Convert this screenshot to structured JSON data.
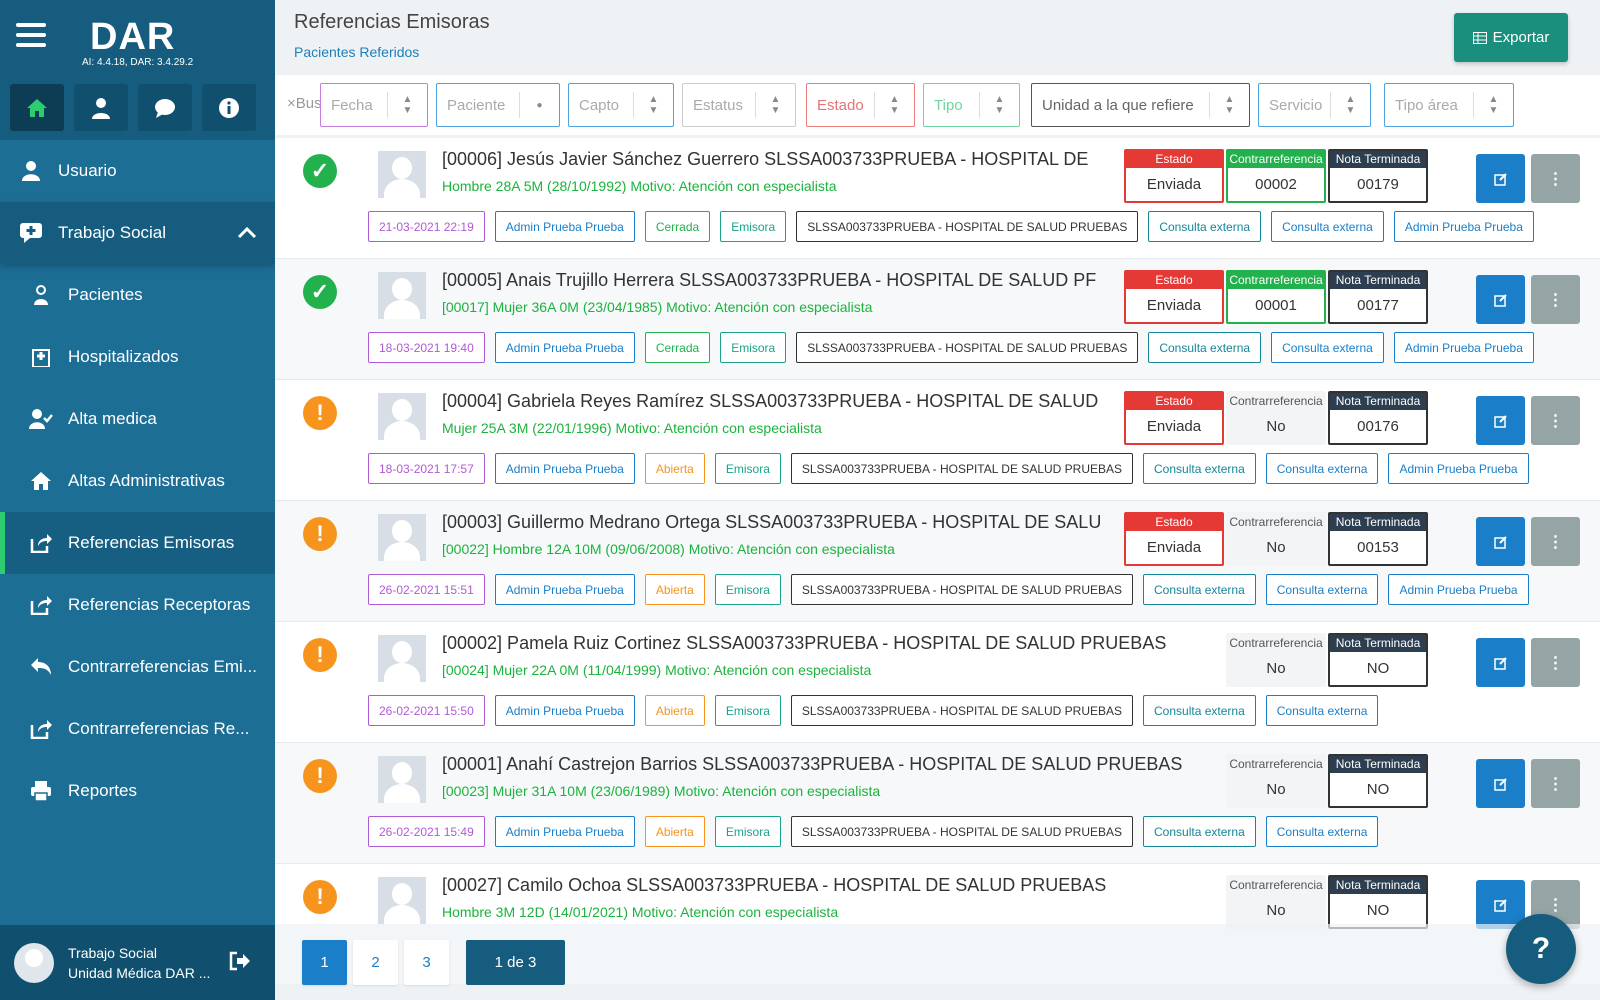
{
  "app": {
    "logo": "DAR",
    "version": "AI: 4.4.18, DAR: 3.4.29.2"
  },
  "sidebar": {
    "items": [
      {
        "label": "Usuario",
        "icon": "user-icon"
      },
      {
        "label": "Trabajo Social",
        "icon": "chat-plus-icon"
      },
      {
        "label": "Pacientes",
        "icon": "patient-icon"
      },
      {
        "label": "Hospitalizados",
        "icon": "hospital-icon"
      },
      {
        "label": "Alta medica",
        "icon": "user-check-icon"
      },
      {
        "label": "Altas Administrativas",
        "icon": "home-icon"
      },
      {
        "label": "Referencias Emisoras",
        "icon": "share-icon"
      },
      {
        "label": "Referencias Receptoras",
        "icon": "share-icon"
      },
      {
        "label": "Contrarreferencias Emi...",
        "icon": "reply-icon"
      },
      {
        "label": "Contrarreferencias Re...",
        "icon": "share-icon"
      },
      {
        "label": "Reportes",
        "icon": "print-icon"
      }
    ],
    "user": {
      "name": "Trabajo Social",
      "unit": "Unidad Médica DAR ..."
    }
  },
  "header": {
    "title": "Referencias Emisoras",
    "subtitle": "Pacientes Referidos",
    "export_label": "Exportar"
  },
  "filters": {
    "buscar": "×Buscar",
    "fecha": "Fecha",
    "paciente": "Paciente",
    "capto": "Capto",
    "estatus": "Estatus",
    "estado": "Estado",
    "tipo": "Tipo",
    "unidad": "Unidad a la que refiere",
    "servicio": "Servicio",
    "tipo_area": "Tipo área"
  },
  "box_labels": {
    "estado": "Estado",
    "contra": "Contrarreferencia",
    "nota": "Nota Terminada"
  },
  "rows": [
    {
      "title": "[00006] Jesús Javier Sánchez Guerrero SLSSA003733PRUEBA - HOSPITAL DE",
      "info": "Hombre 28A 5M (28/10/1992) Motivo: Atención con especialista",
      "estado": "Enviada",
      "contra": "00002",
      "nota": "00179",
      "date": "21-03-2021 22:19",
      "user": "Admin Prueba Prueba",
      "status": "Cerrada",
      "tipo": "Emisora",
      "hospital": "SLSSA003733PRUEBA - HOSPITAL DE SALUD PRUEBAS",
      "serv1": "Consulta externa",
      "serv2": "Consulta externa",
      "user2": "Admin Prueba Prueba"
    },
    {
      "title": "[00005] Anais Trujillo Herrera SLSSA003733PRUEBA - HOSPITAL DE SALUD PF",
      "info": "[00017] Mujer 36A 0M (23/04/1985) Motivo: Atención con especialista",
      "estado": "Enviada",
      "contra": "00001",
      "nota": "00177",
      "date": "18-03-2021 19:40",
      "user": "Admin Prueba Prueba",
      "status": "Cerrada",
      "tipo": "Emisora",
      "hospital": "SLSSA003733PRUEBA - HOSPITAL DE SALUD PRUEBAS",
      "serv1": "Consulta externa",
      "serv2": "Consulta externa",
      "user2": "Admin Prueba Prueba"
    },
    {
      "title": "[00004] Gabriela Reyes Ramírez SLSSA003733PRUEBA - HOSPITAL DE SALUD",
      "info": "Mujer 25A 3M (22/01/1996) Motivo: Atención con especialista",
      "estado": "Enviada",
      "contra": "No",
      "nota": "00176",
      "date": "18-03-2021 17:57",
      "user": "Admin Prueba Prueba",
      "status": "Abierta",
      "tipo": "Emisora",
      "hospital": "SLSSA003733PRUEBA - HOSPITAL DE SALUD PRUEBAS",
      "serv1": "Consulta externa",
      "serv2": "Consulta externa",
      "user2": "Admin Prueba Prueba"
    },
    {
      "title": "[00003] Guillermo Medrano Ortega SLSSA003733PRUEBA - HOSPITAL DE SALU",
      "info": "[00022] Hombre 12A 10M (09/06/2008) Motivo: Atención con especialista",
      "estado": "Enviada",
      "contra": "No",
      "nota": "00153",
      "date": "26-02-2021 15:51",
      "user": "Admin Prueba Prueba",
      "status": "Abierta",
      "tipo": "Emisora",
      "hospital": "SLSSA003733PRUEBA - HOSPITAL DE SALUD PRUEBAS",
      "serv1": "Consulta externa",
      "serv2": "Consulta externa",
      "user2": "Admin Prueba Prueba"
    },
    {
      "title": "[00002] Pamela Ruiz Cortinez SLSSA003733PRUEBA - HOSPITAL DE SALUD PRUEBAS",
      "info": "[00024] Mujer 22A 0M (11/04/1999) Motivo: Atención con especialista",
      "contra": "No",
      "nota": "NO",
      "date": "26-02-2021 15:50",
      "user": "Admin Prueba Prueba",
      "status": "Abierta",
      "tipo": "Emisora",
      "hospital": "SLSSA003733PRUEBA - HOSPITAL DE SALUD PRUEBAS",
      "serv1": "Consulta externa",
      "serv2": "Consulta externa"
    },
    {
      "title": "[00001] Anahí Castrejon Barrios SLSSA003733PRUEBA - HOSPITAL DE SALUD PRUEBAS",
      "info": "[00023] Mujer 31A 10M (23/06/1989) Motivo: Atención con especialista",
      "contra": "No",
      "nota": "NO",
      "date": "26-02-2021 15:49",
      "user": "Admin Prueba Prueba",
      "status": "Abierta",
      "tipo": "Emisora",
      "hospital": "SLSSA003733PRUEBA - HOSPITAL DE SALUD PRUEBAS",
      "serv1": "Consulta externa",
      "serv2": "Consulta externa"
    },
    {
      "title": "[00027] Camilo Ochoa SLSSA003733PRUEBA - HOSPITAL DE SALUD PRUEBAS",
      "info": "Hombre 3M 12D (14/01/2021) Motivo: Atención con especialista",
      "contra": "No",
      "nota": "NO",
      "date": "",
      "user": "",
      "status": "",
      "tipo": "",
      "hospital": "",
      "serv1": "",
      "serv2": ""
    }
  ],
  "pager": {
    "p1": "1",
    "p2": "2",
    "p3": "3",
    "info": "1 de 3"
  },
  "help": "?",
  "colors": {
    "sidebar": "#1d6e94",
    "accent_green": "#22b14c",
    "accent_blue": "#1a7fc8",
    "warning": "#f7941d",
    "danger": "#e53935"
  }
}
